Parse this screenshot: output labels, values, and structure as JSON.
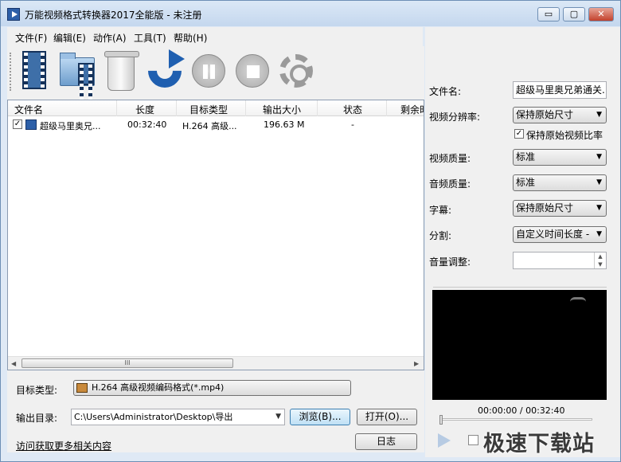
{
  "window": {
    "title": "万能视频格式转换器2017全能版 - 未注册",
    "min_label": "▭",
    "max_label": "▢",
    "close_label": "✕"
  },
  "menu": [
    "文件(F)",
    "编辑(E)",
    "动作(A)",
    "工具(T)",
    "帮助(H)"
  ],
  "toolbar": {
    "icons": [
      "add-video-icon",
      "add-folder-icon",
      "delete-icon",
      "convert-icon",
      "pause-icon",
      "stop-icon",
      "settings-icon"
    ]
  },
  "file_list": {
    "columns": [
      "文件名",
      "长度",
      "目标类型",
      "输出大小",
      "状态",
      "剩余时"
    ],
    "rows": [
      {
        "checked": true,
        "name": "超级马里奥兄...",
        "length": "00:32:40",
        "target": "H.264 高级...",
        "size": "196.63 M",
        "status": "-"
      }
    ],
    "scroll_grip": "III"
  },
  "bottom": {
    "target_type_label": "目标类型:",
    "target_type_value": "H.264 高级视频编码格式(*.mp4)",
    "output_dir_label": "输出目录:",
    "output_dir_value": "C:\\Users\\Administrator\\Desktop\\导出",
    "browse_label": "浏览(B)...",
    "open_label": "打开(O)...",
    "log_label": "日志",
    "link_text": "访问获取更多相关内容"
  },
  "settings": {
    "filename_label": "文件名:",
    "filename_value": "超级马里奥兄弟通关.",
    "resolution_label": "视频分辨率:",
    "resolution_value": "保持原始尺寸",
    "keep_ratio_label": "保持原始视频比率",
    "keep_ratio_checked": true,
    "video_quality_label": "视频质量:",
    "video_quality_value": "标准",
    "audio_quality_label": "音频质量:",
    "audio_quality_value": "标准",
    "subtitle_label": "字幕:",
    "subtitle_value": "保持原始尺寸",
    "split_label": "分割:",
    "split_value": "自定义时间长度 -",
    "volume_label": "音量调整:",
    "volume_value": ""
  },
  "player": {
    "time": "00:00:00 / 00:32:40",
    "progress": 0.0
  },
  "watermark": "极速下载站"
}
